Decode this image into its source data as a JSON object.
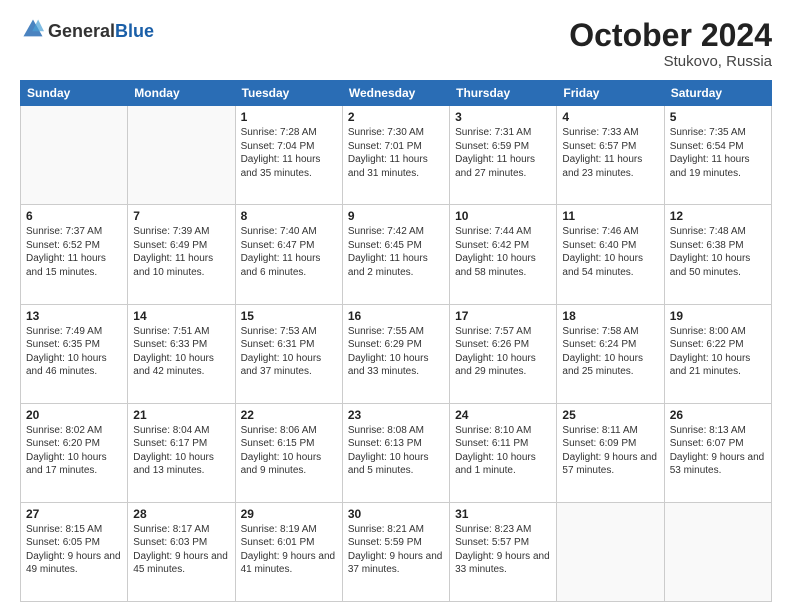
{
  "header": {
    "logo_line1": "General",
    "logo_line2": "Blue",
    "month": "October 2024",
    "location": "Stukovo, Russia"
  },
  "weekdays": [
    "Sunday",
    "Monday",
    "Tuesday",
    "Wednesday",
    "Thursday",
    "Friday",
    "Saturday"
  ],
  "weeks": [
    [
      {
        "day": "",
        "info": ""
      },
      {
        "day": "",
        "info": ""
      },
      {
        "day": "1",
        "info": "Sunrise: 7:28 AM\nSunset: 7:04 PM\nDaylight: 11 hours\nand 35 minutes."
      },
      {
        "day": "2",
        "info": "Sunrise: 7:30 AM\nSunset: 7:01 PM\nDaylight: 11 hours\nand 31 minutes."
      },
      {
        "day": "3",
        "info": "Sunrise: 7:31 AM\nSunset: 6:59 PM\nDaylight: 11 hours\nand 27 minutes."
      },
      {
        "day": "4",
        "info": "Sunrise: 7:33 AM\nSunset: 6:57 PM\nDaylight: 11 hours\nand 23 minutes."
      },
      {
        "day": "5",
        "info": "Sunrise: 7:35 AM\nSunset: 6:54 PM\nDaylight: 11 hours\nand 19 minutes."
      }
    ],
    [
      {
        "day": "6",
        "info": "Sunrise: 7:37 AM\nSunset: 6:52 PM\nDaylight: 11 hours\nand 15 minutes."
      },
      {
        "day": "7",
        "info": "Sunrise: 7:39 AM\nSunset: 6:49 PM\nDaylight: 11 hours\nand 10 minutes."
      },
      {
        "day": "8",
        "info": "Sunrise: 7:40 AM\nSunset: 6:47 PM\nDaylight: 11 hours\nand 6 minutes."
      },
      {
        "day": "9",
        "info": "Sunrise: 7:42 AM\nSunset: 6:45 PM\nDaylight: 11 hours\nand 2 minutes."
      },
      {
        "day": "10",
        "info": "Sunrise: 7:44 AM\nSunset: 6:42 PM\nDaylight: 10 hours\nand 58 minutes."
      },
      {
        "day": "11",
        "info": "Sunrise: 7:46 AM\nSunset: 6:40 PM\nDaylight: 10 hours\nand 54 minutes."
      },
      {
        "day": "12",
        "info": "Sunrise: 7:48 AM\nSunset: 6:38 PM\nDaylight: 10 hours\nand 50 minutes."
      }
    ],
    [
      {
        "day": "13",
        "info": "Sunrise: 7:49 AM\nSunset: 6:35 PM\nDaylight: 10 hours\nand 46 minutes."
      },
      {
        "day": "14",
        "info": "Sunrise: 7:51 AM\nSunset: 6:33 PM\nDaylight: 10 hours\nand 42 minutes."
      },
      {
        "day": "15",
        "info": "Sunrise: 7:53 AM\nSunset: 6:31 PM\nDaylight: 10 hours\nand 37 minutes."
      },
      {
        "day": "16",
        "info": "Sunrise: 7:55 AM\nSunset: 6:29 PM\nDaylight: 10 hours\nand 33 minutes."
      },
      {
        "day": "17",
        "info": "Sunrise: 7:57 AM\nSunset: 6:26 PM\nDaylight: 10 hours\nand 29 minutes."
      },
      {
        "day": "18",
        "info": "Sunrise: 7:58 AM\nSunset: 6:24 PM\nDaylight: 10 hours\nand 25 minutes."
      },
      {
        "day": "19",
        "info": "Sunrise: 8:00 AM\nSunset: 6:22 PM\nDaylight: 10 hours\nand 21 minutes."
      }
    ],
    [
      {
        "day": "20",
        "info": "Sunrise: 8:02 AM\nSunset: 6:20 PM\nDaylight: 10 hours\nand 17 minutes."
      },
      {
        "day": "21",
        "info": "Sunrise: 8:04 AM\nSunset: 6:17 PM\nDaylight: 10 hours\nand 13 minutes."
      },
      {
        "day": "22",
        "info": "Sunrise: 8:06 AM\nSunset: 6:15 PM\nDaylight: 10 hours\nand 9 minutes."
      },
      {
        "day": "23",
        "info": "Sunrise: 8:08 AM\nSunset: 6:13 PM\nDaylight: 10 hours\nand 5 minutes."
      },
      {
        "day": "24",
        "info": "Sunrise: 8:10 AM\nSunset: 6:11 PM\nDaylight: 10 hours\nand 1 minute."
      },
      {
        "day": "25",
        "info": "Sunrise: 8:11 AM\nSunset: 6:09 PM\nDaylight: 9 hours\nand 57 minutes."
      },
      {
        "day": "26",
        "info": "Sunrise: 8:13 AM\nSunset: 6:07 PM\nDaylight: 9 hours\nand 53 minutes."
      }
    ],
    [
      {
        "day": "27",
        "info": "Sunrise: 8:15 AM\nSunset: 6:05 PM\nDaylight: 9 hours\nand 49 minutes."
      },
      {
        "day": "28",
        "info": "Sunrise: 8:17 AM\nSunset: 6:03 PM\nDaylight: 9 hours\nand 45 minutes."
      },
      {
        "day": "29",
        "info": "Sunrise: 8:19 AM\nSunset: 6:01 PM\nDaylight: 9 hours\nand 41 minutes."
      },
      {
        "day": "30",
        "info": "Sunrise: 8:21 AM\nSunset: 5:59 PM\nDaylight: 9 hours\nand 37 minutes."
      },
      {
        "day": "31",
        "info": "Sunrise: 8:23 AM\nSunset: 5:57 PM\nDaylight: 9 hours\nand 33 minutes."
      },
      {
        "day": "",
        "info": ""
      },
      {
        "day": "",
        "info": ""
      }
    ]
  ]
}
